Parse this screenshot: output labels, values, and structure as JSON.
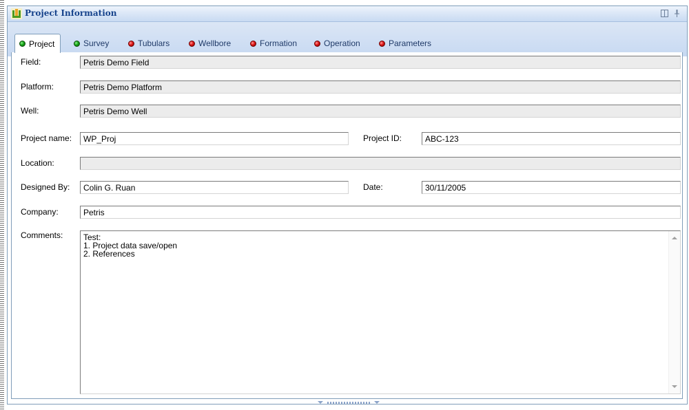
{
  "window": {
    "title": "Project Information"
  },
  "tabs": [
    {
      "label": "Project",
      "status": "green",
      "active": true
    },
    {
      "label": "Survey",
      "status": "green",
      "active": false
    },
    {
      "label": "Tubulars",
      "status": "red",
      "active": false
    },
    {
      "label": "Wellbore",
      "status": "red",
      "active": false
    },
    {
      "label": "Formation",
      "status": "red",
      "active": false
    },
    {
      "label": "Operation",
      "status": "red",
      "active": false
    },
    {
      "label": "Parameters",
      "status": "red",
      "active": false
    }
  ],
  "form": {
    "field": {
      "label": "Field:",
      "value": "Petris Demo Field"
    },
    "platform": {
      "label": "Platform:",
      "value": "Petris Demo Platform"
    },
    "well": {
      "label": "Well:",
      "value": "Petris Demo Well"
    },
    "project_name": {
      "label": "Project name:",
      "value": "WP_Proj"
    },
    "project_id": {
      "label": "Project ID:",
      "value": "ABC-123"
    },
    "location": {
      "label": "Location:",
      "value": ""
    },
    "designed_by": {
      "label": "Designed By:",
      "value": "Colin G. Ruan"
    },
    "date": {
      "label": "Date:",
      "value": "30/11/2005"
    },
    "company": {
      "label": "Company:",
      "value": "Petris"
    },
    "comments": {
      "label": "Comments:",
      "value": "Test:\n1. Project data save/open\n2. References"
    }
  },
  "colors": {
    "status_green": "#17a717",
    "status_red": "#e01818",
    "title_text": "#15428b",
    "border": "#7f9db9"
  },
  "icons": {
    "app": "app-logo-icon",
    "dock": "dock-window-icon",
    "pin": "pin-icon"
  }
}
